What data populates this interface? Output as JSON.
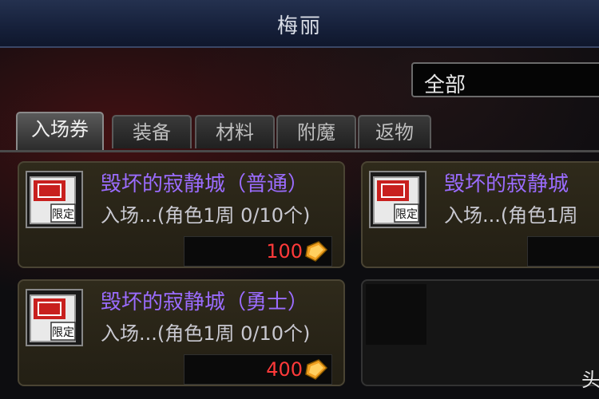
{
  "window": {
    "title": "梅丽"
  },
  "filter": {
    "value": "全部"
  },
  "tabs": [
    {
      "label": "入场券",
      "active": true
    },
    {
      "label": "装备",
      "active": false
    },
    {
      "label": "材料",
      "active": false
    },
    {
      "label": "附魔",
      "active": false
    },
    {
      "label": "返物",
      "active": false
    }
  ],
  "items": [
    {
      "name": "毁坏的寂静城（普通）",
      "sub": "入场...(角色1周 0/10个)",
      "price": "100",
      "icon": "ticket-limited-icon",
      "badge": "限定"
    },
    {
      "name": "毁坏的寂静城",
      "sub": "入场...(角色1周",
      "price": "",
      "icon": "ticket-limited-icon",
      "badge": "限定"
    },
    {
      "name": "毁坏的寂静城（勇士）",
      "sub": "入场...(角色1周 0/10个)",
      "price": "400",
      "icon": "ticket-limited-icon",
      "badge": "限定"
    }
  ],
  "watermark": "头",
  "colors": {
    "item_name": "#9b6cff",
    "price": "#ff3a3a",
    "coin": "#f0a020"
  }
}
